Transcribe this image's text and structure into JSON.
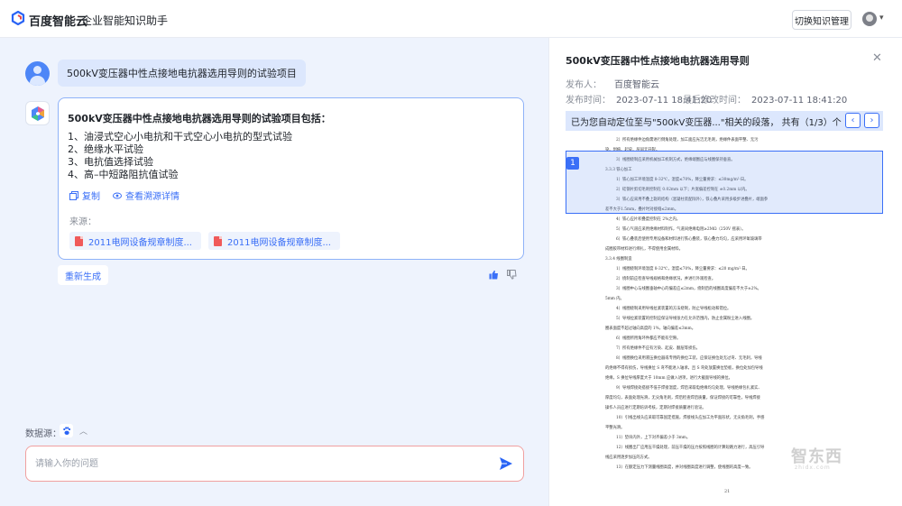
{
  "header": {
    "brand": "百度智能云",
    "product": "企业智能知识助手",
    "switch_kb_button": "切换知识管理"
  },
  "chat": {
    "question": "500kV变压器中性点接地电抗器选用导则的试验项目",
    "answer": {
      "title": "500kV变压器中性点接地电抗器选用导则的试验项目包括：",
      "items": [
        "1、油浸式空心小电抗和干式空心小电抗的型式试验",
        "2、绝缘水平试验",
        "3、电抗值选择试验",
        "4、高–中短路阻抗值试验"
      ],
      "copy_label": "复制",
      "trace_label": "查看溯源详情",
      "source_label": "来源：",
      "sources": [
        "2011电网设备规章制度...",
        "2011电网设备规章制度..."
      ]
    },
    "regenerate_label": "重新生成",
    "datasource_label": "数据源：",
    "input_placeholder": "请输入你的问题"
  },
  "doc_panel": {
    "title": "500kV变压器中性点接地电抗器选用导则",
    "publisher_label": "发布人：",
    "publisher": "百度智能云",
    "publish_time_label": "发布时间：",
    "publish_time": "2023-07-11 18:41:20",
    "modified_time_label": "最后修改时间：",
    "modified_time": "2023-07-11 18:41:20",
    "locate_text": "已为您自动定位至与\"500kV变压器...\"相关的段落，  共有（1/3）个",
    "highlight_index": "1",
    "page_number": "21",
    "lines": [
      "2）所有绝缘件边角需进行倒角处理，加工面应光洁无毛刺，绝缘件表面平整、无污",
      "染、划痕、起皮、层间无开裂。",
      "3）线圈绕制应采用机械加工机制方式，绝缘端圈应与线圈保持垂直。",
      "3.3.3 铁心加工",
      "1）铁心加工环境温度 8-32℃，湿度≤70%，降尘量要求：≤30mg/m²·日。",
      "2）硅钢片剪切毛刺控制在 0.02mm 以下；片宽偏差控制在 ±0.2mm 以内。",
      "3）铁心应采用不叠上轭的结构（混凝柱装配除外），铁心叠片采用多级步进叠片，端面参",
      "差不大于1.5mm，叠片时对接缝≤2mm。",
      "4）铁心应片积叠度控制在 2%之内。",
      "5）铁心气道应采用绝缘材料制作，气道间绝缘电阻≥2MΩ（250V 摇表）。",
      "6）铁心叠装后使用专用设备和材料进行铁心叠装，铁心叠力均匀，应采用环氧玻璃带",
      "成圈胶带材料进行绑扎，不得使用金属材料。",
      "3.3.4 线圈制造",
      "1）线圈绕制环境温度 8-32℃，湿度≤70%，降尘量要求：≤20 mg/m²·日。",
      "2）绕制前应检查导线规格和绝缘状况，并进行外观检查。",
      "3）线圈中心与线圈垂轴中心的偏差应≤2mm，绕制后的线圈高度偏差不大于±2%。",
      "5mm 内。",
      "4）线圈绕制采用导线拉紧装置的方法绕制，防止导线松动和错位。",
      "5）导线拉紧装置的控制应保证导线张力在允许范围内，防止金属粉尘进入线圈。",
      "圈表面度不超过轴向高度的 1%，轴向偏差≤3mm。",
      "6）线圈所用角环件都应不能有空隙。",
      "7）所有绝缘件不应有污染、起皮、翻层等损伤。",
      "8）线圈换位采用液压换位器或专用的换位工装，应保证换位处无过弯、无毛刺，导线",
      "的绝缘不得有损伤，导线换位 S 弯不能进入轴承，且 S 弯处放置换位垫板，换位处加包导线",
      "绝缘，S 换位导线厚度大于 10mm 应做入进项，进行大截面导线的换位。",
      "9）导线焊接处搭接不低于焊接温度，焊后采取电绝缘均匀处理，导线绝缘包扎紧实、",
      "厚度均匀，表面处理光滑，无尖角毛刺，焊后检查焊后质量，保证焊接的可靠性，导线焊接",
      "操作人员应进行定期培训考核，定期对焊接质量进行验证。",
      "10）引线出线头应采取可靠固定措施，焊接线头应加工为平面形状，无尖角毛刺，手感",
      "平整光滑。",
      "11）垫块内外，上下对齐偏差小于 3mm。",
      "12）线圈出厂应用压干燥处理，前压干燥的压力按照线圈的计算短路力进行，高压引导",
      "线应采用逐步加压的方式。",
      "13）在额定压力下测量线圈高度，并对线圈高度进行调整，使线圈的高度一致。"
    ]
  },
  "watermark": {
    "text": "智东西",
    "sub": "zhidx.com"
  }
}
